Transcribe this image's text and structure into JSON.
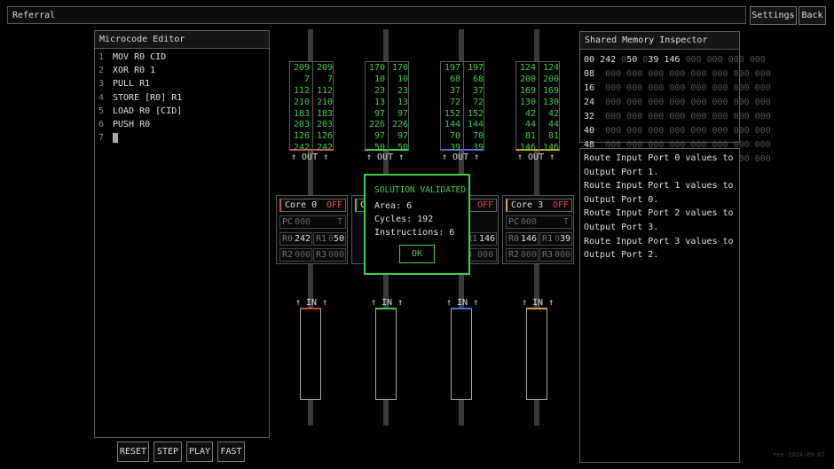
{
  "topbar": {
    "title": "Referral",
    "settings_label": "Settings",
    "back_label": "Back"
  },
  "editor": {
    "title": "Microcode Editor",
    "lines": [
      {
        "num": "1",
        "text": "MOV R0 CID"
      },
      {
        "num": "2",
        "text": "XOR R0 1"
      },
      {
        "num": "3",
        "text": "PULL R1"
      },
      {
        "num": "4",
        "text": "STORE [R0] R1"
      },
      {
        "num": "5",
        "text": "LOAD R0 [CID]"
      },
      {
        "num": "6",
        "text": "PUSH R0"
      },
      {
        "num": "7",
        "text": ""
      }
    ]
  },
  "controls": {
    "reset": "RESET",
    "step": "STEP",
    "play": "PLAY",
    "fast": "FAST"
  },
  "outputs": [
    {
      "label": "↑ OUT ↑",
      "color": "#d44a4a",
      "left": [
        "209",
        "7",
        "112",
        "210",
        "183",
        "203",
        "126",
        "242"
      ],
      "right": [
        "209",
        "7",
        "112",
        "210",
        "183",
        "203",
        "126",
        "242"
      ]
    },
    {
      "label": "↑ OUT ↑",
      "color": "#3fcf4a",
      "left": [
        "170",
        "10",
        "23",
        "13",
        "97",
        "226",
        "97",
        "50"
      ],
      "right": [
        "170",
        "10",
        "23",
        "13",
        "97",
        "226",
        "97",
        "50"
      ]
    },
    {
      "label": "↑ OUT ↑",
      "color": "#4a6ad4",
      "left": [
        "197",
        "68",
        "37",
        "72",
        "152",
        "144",
        "70",
        "39"
      ],
      "right": [
        "197",
        "68",
        "37",
        "72",
        "152",
        "144",
        "70",
        "39"
      ]
    },
    {
      "label": "↑ OUT ↑",
      "color": "#d4a43a",
      "left": [
        "124",
        "200",
        "169",
        "130",
        "42",
        "44",
        "81",
        "146"
      ],
      "right": [
        "124",
        "200",
        "169",
        "130",
        "42",
        "44",
        "81",
        "146"
      ]
    }
  ],
  "inputs": [
    {
      "label": "↑ IN ↑",
      "color": "#d44a4a"
    },
    {
      "label": "↑ IN ↑",
      "color": "#3fcf4a"
    },
    {
      "label": "↑ IN ↑",
      "color": "#4a6ad4"
    },
    {
      "label": "↑ IN ↑",
      "color": "#d4a43a"
    }
  ],
  "cores": [
    {
      "name": "Core 0",
      "status": "OFF",
      "color": "#d44a4a",
      "pc_label": "PC",
      "pc": "000",
      "flag": "T",
      "r0_label": "R0",
      "r0": "242",
      "r1_label": "R1",
      "r1_dim": "0",
      "r1": "50",
      "r2_label": "R2",
      "r2": "000",
      "r3_label": "R3",
      "r3": "000"
    },
    {
      "name": "Co",
      "status": "",
      "color": "#3fcf4a"
    },
    {
      "name": "",
      "status": "OFF",
      "color": "#4a6ad4",
      "r1_label": "R1",
      "r1": "146",
      "r3_fragment": "3 000"
    },
    {
      "name": "Core 3",
      "status": "OFF",
      "color": "#d4a43a",
      "pc_label": "PC",
      "pc": "000",
      "flag": "T",
      "r0_label": "R0",
      "r0": "146",
      "r1_label": "R1",
      "r1_dim": "0",
      "r1": "39",
      "r2_label": "R2",
      "r2": "000",
      "r3_label": "R3",
      "r3": "000"
    }
  ],
  "memory": {
    "title": "Shared Memory Inspector",
    "rows": [
      {
        "addr": "00",
        "pre": "242 ",
        "dim1": "0",
        "v1": "50 ",
        "dim2": "0",
        "v2": "39 146",
        "rest": " 000 000 000 000"
      },
      {
        "addr": "08",
        "pre": "",
        "dim1": "",
        "v1": "",
        "dim2": "",
        "v2": "",
        "rest": " 000 000 000 000 000 000 000 000"
      },
      {
        "addr": "16",
        "pre": "",
        "dim1": "",
        "v1": "",
        "dim2": "",
        "v2": "",
        "rest": " 000 000 000 000 000 000 000 000"
      },
      {
        "addr": "24",
        "pre": "",
        "dim1": "",
        "v1": "",
        "dim2": "",
        "v2": "",
        "rest": " 000 000 000 000 000 000 000 000"
      },
      {
        "addr": "32",
        "pre": "",
        "dim1": "",
        "v1": "",
        "dim2": "",
        "v2": "",
        "rest": " 000 000 000 000 000 000 000 000"
      },
      {
        "addr": "40",
        "pre": "",
        "dim1": "",
        "v1": "",
        "dim2": "",
        "v2": "",
        "rest": " 000 000 000 000 000 000 000 000"
      },
      {
        "addr": "48",
        "pre": "",
        "dim1": "",
        "v1": "",
        "dim2": "",
        "v2": "",
        "rest": " 000 000 000 000 000 000 000 000"
      },
      {
        "addr": "56",
        "pre": "",
        "dim1": "",
        "v1": "",
        "dim2": "",
        "v2": "",
        "rest": " 000 000 000 000 000 000 000 000"
      }
    ]
  },
  "goal": {
    "lines": [
      "Route Input Port 0 values to",
      "Output Port 1.",
      "Route Input Port 1 values to",
      "Output Port 0.",
      "Route Input Port 2 values to",
      "Output Port 3.",
      "Route Input Port 3 values to",
      "Output Port 2."
    ]
  },
  "dialog": {
    "title": "SOLUTION VALIDATED",
    "area": "Area: 6",
    "cycles": "Cycles: 192",
    "instructions": "Instructions: 6",
    "ok": "OK"
  },
  "version": "rev-2024-09-07"
}
